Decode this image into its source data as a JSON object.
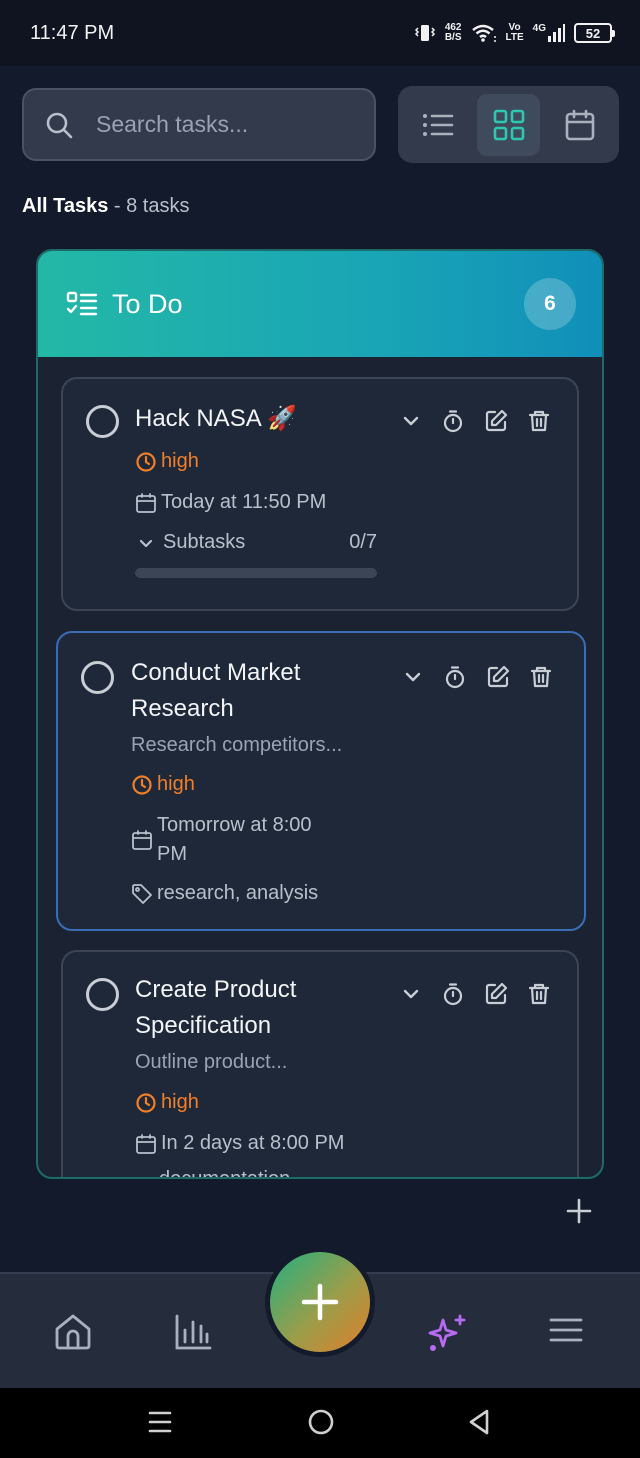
{
  "status_bar": {
    "time": "11:47 PM",
    "net_speed_value": "462",
    "net_speed_unit": "B/S",
    "volte_top": "Vo",
    "volte_bottom": "LTE",
    "network": "4G",
    "battery": "52"
  },
  "search": {
    "placeholder": "Search tasks..."
  },
  "view_toggle": {
    "options": [
      "list",
      "board",
      "calendar"
    ],
    "active": "board"
  },
  "section": {
    "title": "All Tasks",
    "count_text": " - 8 tasks"
  },
  "column": {
    "title": "To Do",
    "count": "6",
    "cards": [
      {
        "title": "Hack NASA 🚀",
        "priority": "high",
        "due": "Today at 11:50 PM",
        "subtasks_label": "Subtasks",
        "subtasks_progress": "0/7",
        "subtasks_fraction": 0
      },
      {
        "title_line1": "Conduct Market",
        "title_line2": "Research",
        "description": "Research competitors...",
        "priority": "high",
        "due_line1": "Tomorrow at 8:00",
        "due_line2": "PM",
        "tags": "research, analysis"
      },
      {
        "title_line1": "Create Product",
        "title_line2": "Specification",
        "description": "Outline product...",
        "priority": "high",
        "due": "In 2 days at 8:00 PM",
        "tags_partial": "documentation"
      }
    ]
  },
  "bottom_nav": {
    "items": [
      "home",
      "analytics",
      "add",
      "ai-assistant",
      "menu"
    ]
  },
  "colors": {
    "accent_teal": "#23b8a6",
    "priority_high": "#f07f2a",
    "ai_purple": "#b76cf0",
    "background": "#131a2b"
  }
}
